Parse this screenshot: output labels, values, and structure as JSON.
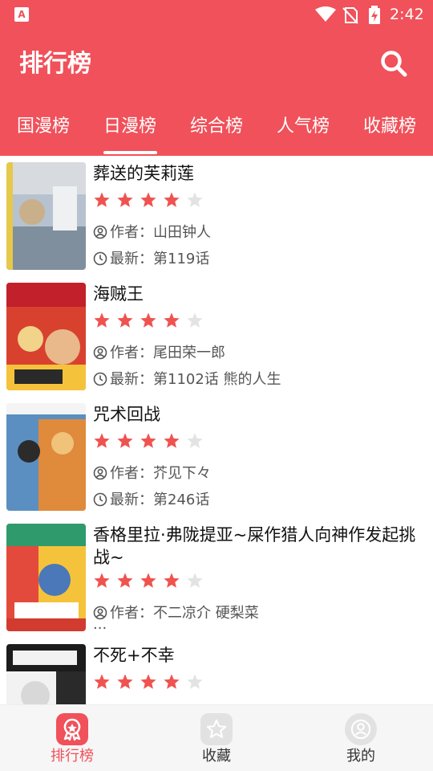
{
  "status_bar": {
    "time": "2:42",
    "app_icon_letter": "A"
  },
  "app_bar": {
    "title": "排行榜",
    "search_icon": "search-icon"
  },
  "tabs": [
    {
      "label": "国漫榜",
      "selected": false
    },
    {
      "label": "日漫榜",
      "selected": true
    },
    {
      "label": "综合榜",
      "selected": false
    },
    {
      "label": "人气榜",
      "selected": false
    },
    {
      "label": "收藏榜",
      "selected": false
    }
  ],
  "list": {
    "author_label": "作者：",
    "latest_label": "最新：",
    "items": [
      {
        "title": "葬送的芙莉莲",
        "rating": 4,
        "max_rating": 5,
        "author": "山田钟人",
        "latest": "第119话",
        "cover_color": "#a9b7c8"
      },
      {
        "title": "海贼王",
        "rating": 4,
        "max_rating": 5,
        "author": "尾田荣一郎",
        "latest": "第1102话 熊的人生",
        "cover_color": "#d9412f"
      },
      {
        "title": "咒术回战",
        "rating": 4,
        "max_rating": 5,
        "author": "芥见下々",
        "latest": "第246话",
        "cover_color": "#3f7fb5"
      },
      {
        "title": "香格里拉·弗陇提亚~屎作猎人向神作发起挑战~",
        "rating": 4,
        "max_rating": 5,
        "author": "不二凉介 硬梨菜",
        "latest": "",
        "cover_color": "#f5c33b"
      },
      {
        "title": "不死+不幸",
        "rating": 4,
        "max_rating": 5,
        "author": "",
        "latest": "",
        "cover_color": "#222222"
      }
    ]
  },
  "bottom_nav": [
    {
      "label": "排行榜",
      "icon": "ranking-icon",
      "active": true
    },
    {
      "label": "收藏",
      "icon": "star-icon",
      "active": false
    },
    {
      "label": "我的",
      "icon": "profile-icon",
      "active": false
    }
  ],
  "colors": {
    "accent": "#f0515a",
    "star_on": "#ef5350",
    "star_off": "#e3e3e3",
    "text_primary": "#111111",
    "text_secondary": "#555555"
  }
}
